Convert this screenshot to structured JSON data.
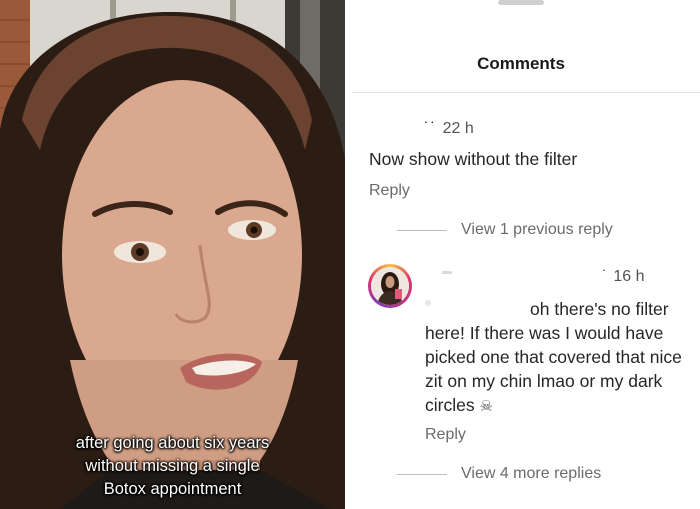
{
  "video": {
    "caption_lines": [
      "after going about six years",
      "without missing a single",
      "Botox appointment"
    ]
  },
  "comments_panel": {
    "title": "Comments",
    "comments": [
      {
        "time": "22 h",
        "text": "Now show without the filter",
        "reply_label": "Reply"
      },
      {
        "time": "16 h",
        "text_line1": "oh there's no filter",
        "text_rest": "here! If there was I would have picked one that covered that nice zit on my chin lmao or my dark circles",
        "emoji_icon": "skull-icon",
        "reply_label": "Reply"
      }
    ],
    "view_previous_label": "View 1 previous reply",
    "view_more_label": "View 4 more replies"
  },
  "colors": {
    "panel_background": "#ffffff",
    "text_primary": "#262626",
    "text_secondary": "#6b6b6b",
    "avatar_ring": "#e1306c"
  }
}
